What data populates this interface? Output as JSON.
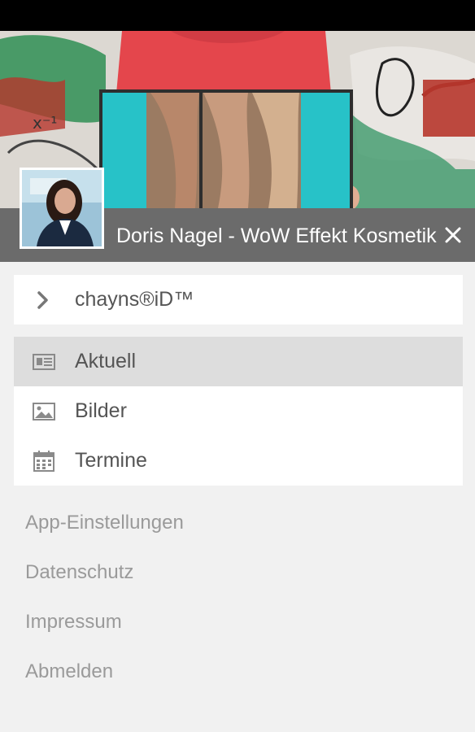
{
  "header": {
    "title": "Doris Nagel - WoW Effekt Kosmetik"
  },
  "account": {
    "label": "chayns®iD™"
  },
  "menu": {
    "items": [
      {
        "label": "Aktuell",
        "icon": "newspaper-icon",
        "active": true
      },
      {
        "label": "Bilder",
        "icon": "image-icon",
        "active": false
      },
      {
        "label": "Termine",
        "icon": "calendar-icon",
        "active": false
      }
    ]
  },
  "footer": {
    "links": [
      "App-Einstellungen",
      "Datenschutz",
      "Impressum",
      "Abmelden"
    ]
  },
  "colors": {
    "title_bar": "#6b6b6b",
    "background": "#f1f1f1",
    "active_item": "#dddddd",
    "hero_teal": "#2fc3c8"
  }
}
